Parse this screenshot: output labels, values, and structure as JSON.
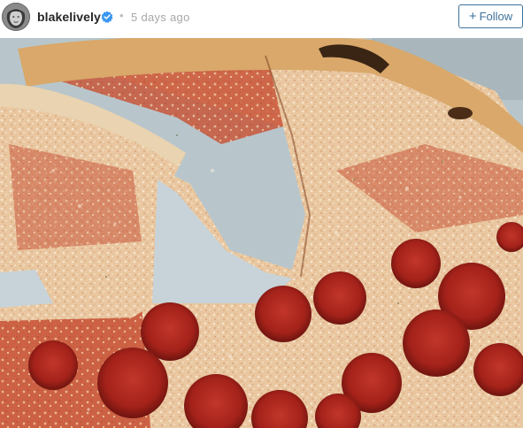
{
  "post": {
    "username": "blakelively",
    "separator": "•",
    "time_ago": "5 days ago",
    "verified": true
  },
  "actions": {
    "follow_label": "Follow",
    "follow_icon": "plus-icon"
  },
  "icons": {
    "avatar": "avatar-image",
    "verified": "verified-badge-icon"
  },
  "colors": {
    "accent": "#3f729b",
    "verified_blue": "#3897f0",
    "username": "#262626",
    "muted": "#a8a8a8"
  }
}
